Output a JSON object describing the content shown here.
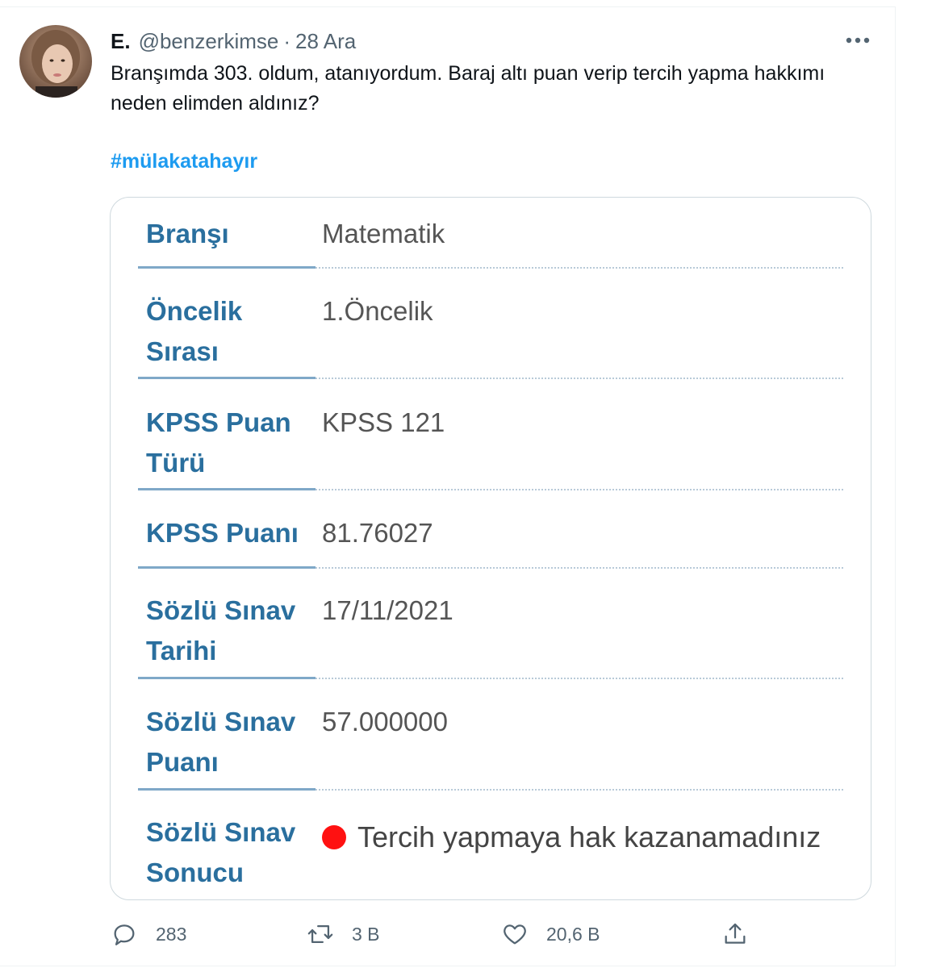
{
  "tweet": {
    "author_name": "E.",
    "handle": "@benzerkimse",
    "separator": "·",
    "date": "28 Ara",
    "text": "Branşımda 303. oldum, atanıyordum. Baraj altı puan verip tercih yapma hakkımı neden elimden aldınız?",
    "hashtag": "#mülakatahayır",
    "more_icon": "more-icon"
  },
  "card": {
    "rows": [
      {
        "label": "Branşı",
        "value": "Matematik"
      },
      {
        "label": "Öncelik Sırası",
        "value": "1.Öncelik"
      },
      {
        "label": "KPSS Puan Türü",
        "value": "KPSS 121"
      },
      {
        "label": "KPSS Puanı",
        "value": "81.76027"
      },
      {
        "label": "Sözlü Sınav Tarihi",
        "value": "17/11/2021"
      },
      {
        "label": "Sözlü Sınav Puanı",
        "value": "57.000000"
      },
      {
        "label": "Sözlü Sınav Sonucu",
        "value": "Tercih yapmaya hak kazanamadınız"
      }
    ],
    "status_color": "#ff1111"
  },
  "actions": {
    "reply_count": "283",
    "retweet_count": "3 B",
    "like_count": "20,6 B",
    "icons": [
      "reply-icon",
      "retweet-icon",
      "like-icon",
      "share-icon"
    ]
  },
  "colors": {
    "hashtag": "#1d9bf0",
    "label_blue": "#2a6f9e",
    "muted": "#536471"
  }
}
